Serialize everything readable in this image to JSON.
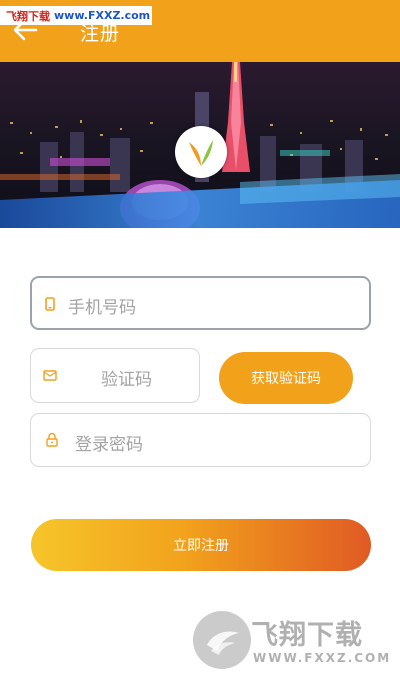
{
  "header": {
    "title": "注册",
    "back_icon": "arrow-left-icon",
    "background": "#f2a11b"
  },
  "watermark": {
    "top_cn": "飞翔下载",
    "top_url": "www.FXXZ.com",
    "bottom_cn": "飞翔下载",
    "bottom_url": "WWW.FXXZ.COM"
  },
  "banner": {
    "logo_icon": "v-logo-icon"
  },
  "form": {
    "phone": {
      "placeholder": "手机号码",
      "icon": "phone-icon"
    },
    "code": {
      "placeholder": "验证码",
      "icon": "envelope-icon"
    },
    "get_code_label": "获取验证码",
    "password": {
      "placeholder": "登录密码",
      "icon": "lock-icon"
    },
    "submit_label": "立即注册"
  },
  "colors": {
    "accent": "#f2a11b",
    "gradient_start": "#f6c52a",
    "gradient_end": "#e05a24"
  }
}
